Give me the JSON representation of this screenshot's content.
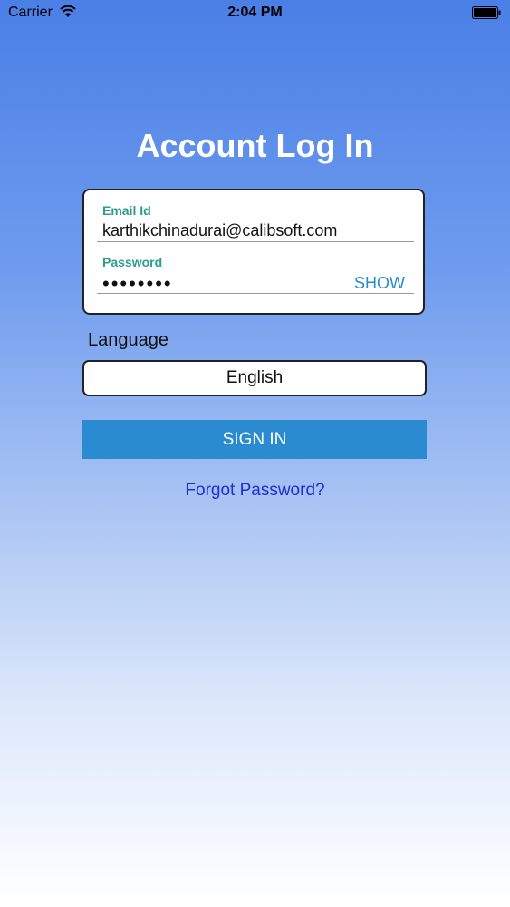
{
  "status_bar": {
    "carrier": "Carrier",
    "time": "2:04 PM",
    "wifi_icon": "wifi-icon",
    "battery_icon": "battery-icon"
  },
  "page": {
    "title": "Account Log In"
  },
  "login_form": {
    "email_label": "Email Id",
    "email_value": "karthikchinadurai@calibsoft.com",
    "password_label": "Password",
    "password_value": "••••••••",
    "show_label": "SHOW"
  },
  "language": {
    "label": "Language",
    "selected": "English"
  },
  "actions": {
    "sign_in_label": "SIGN IN",
    "forgot_password_label": "Forgot Password?"
  },
  "colors": {
    "accent_teal": "#2a9d8f",
    "button_blue": "#2a8bd0",
    "link_blue": "#1f2fd6"
  }
}
